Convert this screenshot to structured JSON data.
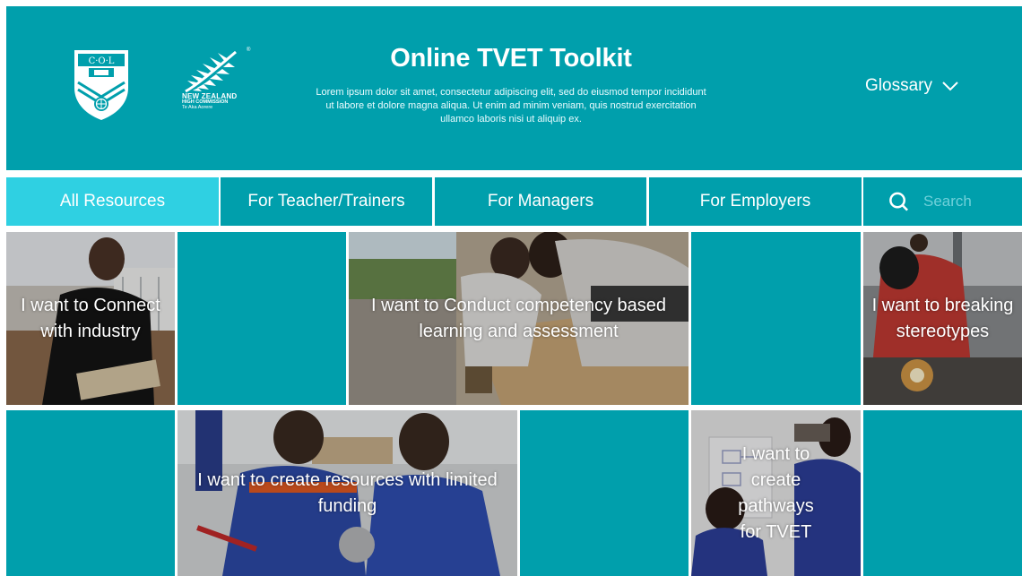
{
  "header": {
    "title": "Online TVET Toolkit",
    "description": "Lorem ipsum dolor sit amet, consectetur adipiscing elit, sed do eiusmod tempor incididunt ut labore et dolore magna aliqua. Ut enim ad minim veniam, quis nostrud exercitation ullamco laboris nisi ut aliquip ex.",
    "glossary_label": "Glossary",
    "col_logo": {
      "text": "C·O·L",
      "icon": "col-shield-logo"
    },
    "nz_logo": {
      "icon": "silver-fern-logo",
      "line1": "NEW ZEALAND",
      "line2": "HIGH COMMISSION",
      "line3": "Te Aka Aorere",
      "mark": "®"
    }
  },
  "nav": {
    "tabs": [
      {
        "label": "All Resources",
        "active": true
      },
      {
        "label": "For Teacher/Trainers",
        "active": false
      },
      {
        "label": "For Managers",
        "active": false
      },
      {
        "label": "For Employers",
        "active": false
      }
    ],
    "search": {
      "placeholder": "Search",
      "icon": "search-icon"
    }
  },
  "tiles": [
    {
      "label": "I want to Connect with industry"
    },
    {
      "label": "I want to Conduct competency based learning and assessment"
    },
    {
      "label": "I want to breaking stereotypes"
    },
    {
      "label": "I want to create resources with limited funding"
    },
    {
      "label": "I want to create pathways for TVET"
    }
  ],
  "colors": {
    "teal": "#009fac",
    "active_tab": "#2fd0e2",
    "search_placeholder": "#6fd0da"
  }
}
